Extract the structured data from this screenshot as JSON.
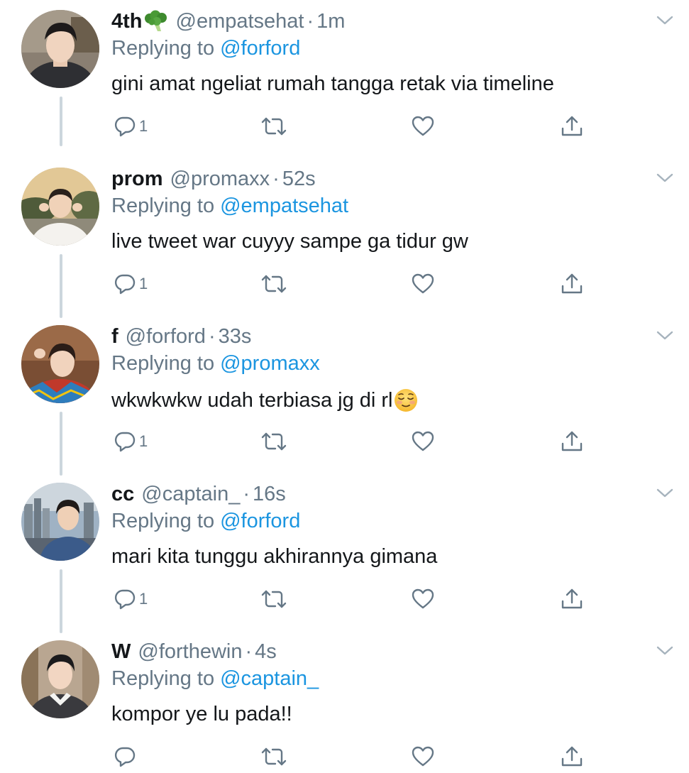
{
  "colors": {
    "link": "#1b95e0",
    "muted": "#657786",
    "text": "#14171a",
    "thread_line": "#ccd6dd",
    "icon": "#657786"
  },
  "tweets": [
    {
      "name": "4th",
      "name_emoji": "broccoli-icon",
      "handle": "@empatsehat",
      "separator": "·",
      "time": "1m",
      "reply_prefix": "Replying to",
      "reply_to": "@forford",
      "text": "gini amat ngeliat rumah tangga retak via timeline",
      "reply_count": "1"
    },
    {
      "name": "prom",
      "handle": "@promaxx",
      "separator": "·",
      "time": "52s",
      "reply_prefix": "Replying to",
      "reply_to": "@empatsehat",
      "text": "live tweet war cuyyy sampe ga tidur gw",
      "reply_count": "1"
    },
    {
      "name": "f",
      "handle": "@forford",
      "separator": "·",
      "time": "33s",
      "reply_prefix": "Replying to",
      "reply_to": "@promaxx",
      "text": "wkwkwkw udah terbiasa jg di rl",
      "text_emoji": "relieved-face-icon",
      "reply_count": "1"
    },
    {
      "name": "cc",
      "handle": "@captain_",
      "separator": "·",
      "time": "16s",
      "reply_prefix": "Replying to",
      "reply_to": "@forford",
      "text": "mari kita tunggu akhirannya gimana",
      "reply_count": "1"
    },
    {
      "name": "W",
      "handle": "@forthewin",
      "separator": "·",
      "time": "4s",
      "reply_prefix": "Replying to",
      "reply_to": "@captain_",
      "text": "kompor ye lu pada!!",
      "reply_count": ""
    }
  ]
}
